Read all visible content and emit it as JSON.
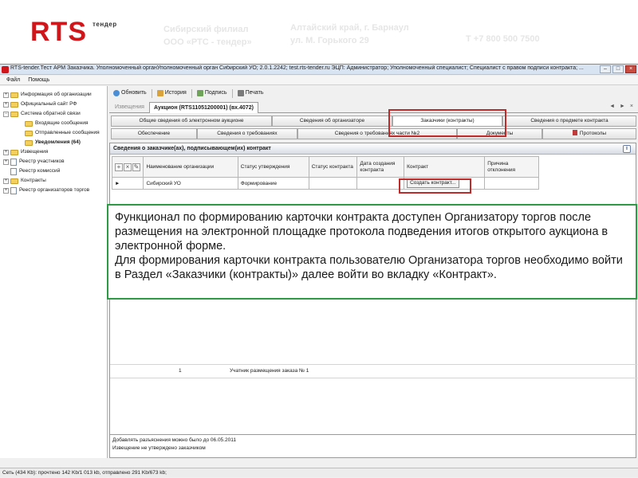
{
  "slide_header": {
    "logo_text": "RTS",
    "logo_tender": "тендер",
    "branch_line1": "Сибирский филиал",
    "branch_line2": "ООО «РТС - тендер»",
    "address_line1": "Алтайский край, г. Барнаул",
    "address_line2": "ул. М. Горького 29",
    "phone": "Т +7 800 500 7500"
  },
  "window": {
    "title": "RTS-tender.Тест АРМ Заказчика. Уполномоченный органУполномоченный орган Сибирский УО; 2.0.1.2242; test.rts-tender.ru ЭЦП: Администратор; Уполномоченный специалист; Специалист с правом подписи контракта; ...",
    "controls": [
      "–",
      "□",
      "×"
    ]
  },
  "menu": {
    "items": [
      "Файл",
      "Помощь"
    ]
  },
  "tree": {
    "items": [
      {
        "label": "Информация об организации",
        "indent": 0,
        "expander": "+",
        "type": "folder",
        "bold": false
      },
      {
        "label": "Официальный сайт РФ",
        "indent": 0,
        "expander": "+",
        "type": "folder",
        "bold": false
      },
      {
        "label": "Система обратной связи",
        "indent": 0,
        "expander": "−",
        "type": "folder",
        "bold": false
      },
      {
        "label": "Входящие сообщения",
        "indent": 1,
        "expander": "",
        "type": "folder",
        "bold": false
      },
      {
        "label": "Отправленные сообщения",
        "indent": 1,
        "expander": "",
        "type": "folder",
        "bold": false
      },
      {
        "label": "Уведомления (64)",
        "indent": 1,
        "expander": "",
        "type": "folder",
        "bold": true
      },
      {
        "label": "Извещения",
        "indent": 0,
        "expander": "+",
        "type": "folder",
        "bold": false
      },
      {
        "label": "Реестр участников",
        "indent": 0,
        "expander": "+",
        "type": "doc",
        "bold": false
      },
      {
        "label": "Реестр комиссий",
        "indent": 0,
        "expander": "",
        "type": "doc",
        "bold": false
      },
      {
        "label": "Контракты",
        "indent": 0,
        "expander": "+",
        "type": "folder",
        "bold": false
      },
      {
        "label": "Реестр организаторов торгов",
        "indent": 0,
        "expander": "+",
        "type": "doc",
        "bold": false
      }
    ]
  },
  "toolbar": {
    "refresh": "Обновить",
    "history": "История",
    "sign": "Подпись",
    "print": "Печать"
  },
  "doc_tabs": {
    "inactive": "Извещения",
    "active": "Аукцион (RTS11051200001) (вх.4072)",
    "nav": "◄ ► ×"
  },
  "section_tabs": {
    "row1": [
      "Общие сведения об электронном аукционе",
      "Сведения об организаторе",
      "Заказчики (контракты)",
      "Сведения о предмете контракта"
    ],
    "row2": [
      "Обеспечение",
      "Сведения о требованиях",
      "Сведения о требованиях части №2",
      "Документы",
      "Протоколы"
    ]
  },
  "panel": {
    "title": "Сведения о заказчике(ах), подписывающем(их) контракт",
    "info": "i",
    "columns": [
      "Наименование организации",
      "Статус утверждения",
      "Статус контракта",
      "Дата создания контракта",
      "Контракт",
      "Причина отклонения"
    ],
    "rows": [
      {
        "marker": "►",
        "org": "Сибирский УО",
        "approval": "Формирование",
        "contract_status": "",
        "created": "",
        "contract": "Создать контракт...",
        "reason": ""
      }
    ],
    "lower_row": {
      "num": "1",
      "text": "Учатник размещения заказа № 1"
    }
  },
  "notes": {
    "line1": "Добавлять разъяснения можно было до 06.05.2011",
    "line2": "Извещение не утверждено заказчиком"
  },
  "statusbar": {
    "text": "Сеть (434 Kb): прочтено 142 Kb/1 013 kb, отправлено 291 Kb/673 kb;"
  },
  "callout": {
    "paragraph1": "Функционал по формированию карточки контракта доступен Организатору торгов после размещения на электронной площадке протокола подведения итогов открытого аукциона в электронной форме.",
    "paragraph2": "Для формирования карточки контракта пользователю Организатора торгов необходимо войти в  Раздел «Заказчики (контракты)» далее войти во вкладку «Контракт»."
  },
  "colors": {
    "brand_red": "#d0161b",
    "callout_border": "#2f9a45",
    "highlight_red": "#c02a2a"
  }
}
